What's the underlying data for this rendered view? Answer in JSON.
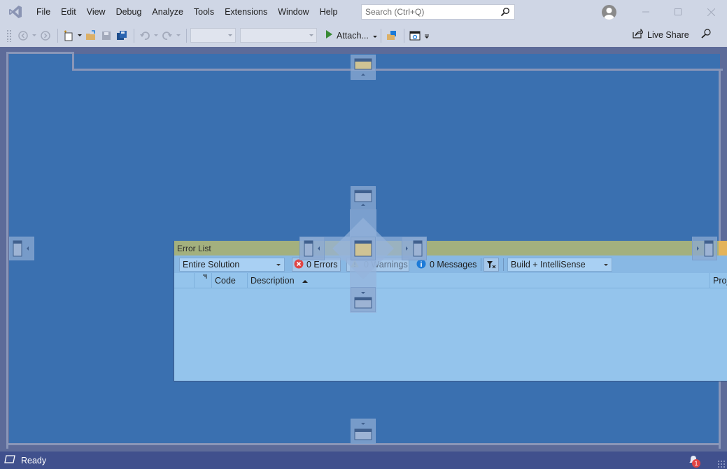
{
  "menu": {
    "items": [
      "File",
      "Edit",
      "View",
      "Debug",
      "Analyze",
      "Tools",
      "Extensions",
      "Window",
      "Help"
    ]
  },
  "search": {
    "placeholder": "Search (Ctrl+Q)"
  },
  "toolbar": {
    "attach_label": "Attach...",
    "live_share_label": "Live Share"
  },
  "error_list": {
    "title": "Error List",
    "scope": "Entire Solution",
    "errors": "0 Errors",
    "warnings": "0 Warnings",
    "messages": "0 Messages",
    "build_filter": "Build + IntelliSense",
    "columns": {
      "code": "Code",
      "description": "Description",
      "project": "Proj"
    }
  },
  "status": {
    "text": "Ready",
    "notification_count": "1"
  },
  "colors": {
    "titlebar_bg": "#cfd6e5",
    "dock_preview": "#3a70b0",
    "status_bg": "#40508d",
    "error_red": "#e04444",
    "info_blue": "#1c7bd8",
    "run_green": "#388a34"
  }
}
